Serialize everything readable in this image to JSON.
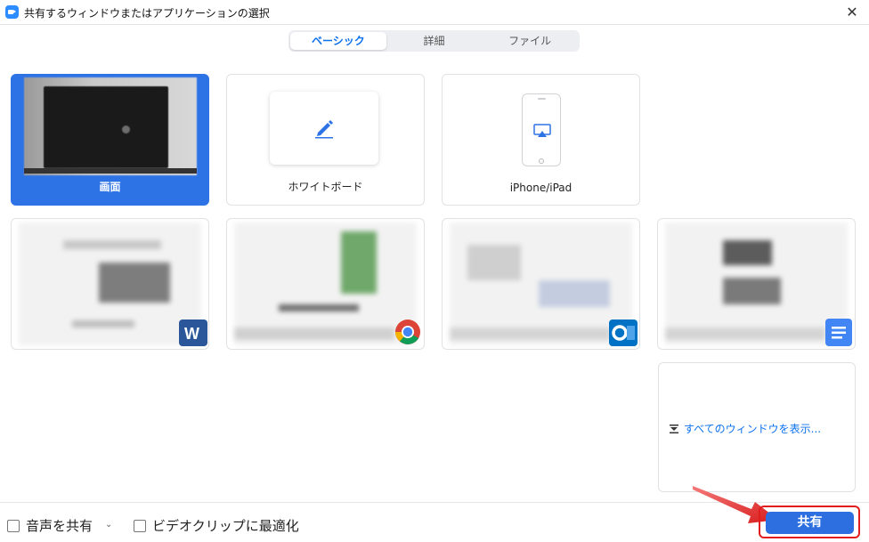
{
  "window": {
    "title": "共有するウィンドウまたはアプリケーションの選択",
    "close_label": "✕"
  },
  "tabs": [
    {
      "label": "ベーシック",
      "active": true
    },
    {
      "label": "詳細",
      "active": false
    },
    {
      "label": "ファイル",
      "active": false
    }
  ],
  "tiles": {
    "screen": {
      "label": "画面"
    },
    "whiteboard": {
      "label": "ホワイトボード"
    },
    "iphone": {
      "label": "iPhone/iPad"
    }
  },
  "app_windows": [
    {
      "app": "Word",
      "icon": "word-icon",
      "color": "#2b579a"
    },
    {
      "app": "Chrome",
      "icon": "chrome-icon",
      "color": "#db4437"
    },
    {
      "app": "Outlook",
      "icon": "outlook-icon",
      "color": "#0072c6"
    },
    {
      "app": "Docs",
      "icon": "docs-icon",
      "color": "#4285f4"
    }
  ],
  "all_windows_link": "すべてのウィンドウを表示...",
  "bottom": {
    "share_audio": "音声を共有",
    "optimize_video": "ビデオクリップに最適化",
    "share_button": "共有"
  },
  "colors": {
    "accent": "#2d73e6",
    "link": "#0e72ed",
    "highlight": "#e11d1d"
  }
}
